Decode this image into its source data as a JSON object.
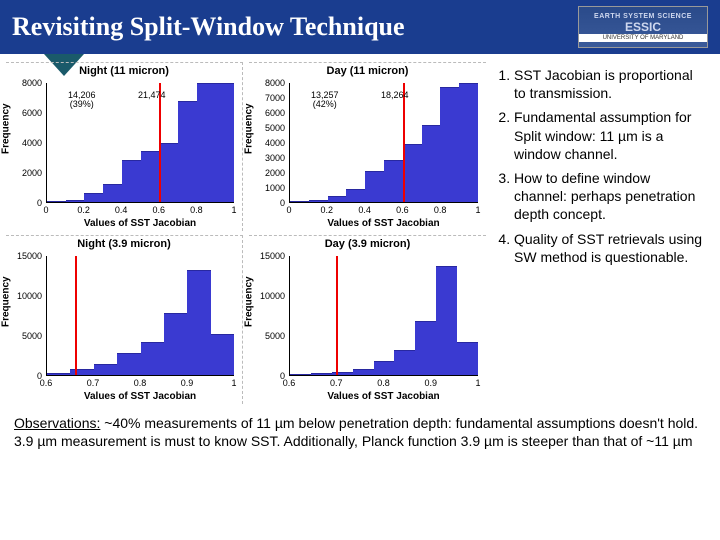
{
  "title": "Revisiting Split-Window Technique",
  "logo": {
    "line1": "EARTH SYSTEM SCIENCE",
    "line2": "UNIVERSITY OF MARYLAND",
    "essic": "ESSIC"
  },
  "charts": [
    {
      "title": "Night (11 micron)",
      "ylabel": "Frequency",
      "xlabel": "Values of SST Jacobian",
      "annot1": "14,206\n(39%)",
      "annot2": "21,474"
    },
    {
      "title": "Day (11 micron)",
      "ylabel": "Frequency",
      "xlabel": "Values of SST Jacobian",
      "annot1": "13,257\n(42%)",
      "annot2": "18,264"
    },
    {
      "title": "Night (3.9 micron)",
      "ylabel": "Frequency",
      "xlabel": "Values of SST Jacobian"
    },
    {
      "title": "Day (3.9 micron)",
      "ylabel": "Frequency",
      "xlabel": "Values of SST Jacobian"
    }
  ],
  "yticks": {
    "a": [
      "0",
      "2000",
      "4000",
      "6000",
      "8000"
    ],
    "b": [
      "0",
      "1000",
      "2000",
      "3000",
      "4000",
      "5000",
      "6000",
      "7000",
      "8000"
    ],
    "c": [
      "0",
      "5000",
      "10000",
      "15000"
    ],
    "d": [
      "0",
      "5000",
      "10000",
      "15000"
    ]
  },
  "xticks": {
    "wide": [
      "0",
      "0.2",
      "0.4",
      "0.6",
      "0.8",
      "1"
    ],
    "narrow": [
      "0.6",
      "0.7",
      "0.8",
      "0.9",
      "1"
    ]
  },
  "notes": [
    "SST Jacobian is proportional to transmission.",
    "Fundamental assumption for Split window: 11 µm is a window channel.",
    "How to define window channel: perhaps penetration depth concept.",
    "Quality of SST retrievals using SW method is questionable."
  ],
  "obs_label": "Observations:",
  "obs": " ~40% measurements of 11 µm below penetration depth: fundamental assumptions doesn't hold. 3.9 µm measurement is must to know SST. Additionally, Planck function 3.9 µm is steeper than that of ~11 µm",
  "chart_data": [
    {
      "type": "bar",
      "title": "Night (11 micron)",
      "xlabel": "Values of SST Jacobian",
      "ylabel": "Frequency",
      "xlim": [
        0,
        1
      ],
      "ylim": [
        0,
        8000
      ],
      "redline_x": 0.6,
      "bin_edges": [
        0,
        0.1,
        0.2,
        0.3,
        0.4,
        0.5,
        0.6,
        0.7,
        0.8,
        0.9,
        1.0
      ],
      "values": [
        0,
        150,
        600,
        1200,
        2800,
        3400,
        4000,
        6800,
        8300,
        8300
      ],
      "annotations": [
        {
          "text": "14,206 (39%)",
          "x": 0.35,
          "y": 7000
        },
        {
          "text": "21,474",
          "x": 0.78,
          "y": 7400
        }
      ]
    },
    {
      "type": "bar",
      "title": "Day (11 micron)",
      "xlabel": "Values of SST Jacobian",
      "ylabel": "Frequency",
      "xlim": [
        0,
        1
      ],
      "ylim": [
        0,
        8000
      ],
      "redline_x": 0.6,
      "bin_edges": [
        0,
        0.1,
        0.2,
        0.3,
        0.4,
        0.5,
        0.6,
        0.7,
        0.8,
        0.9,
        1.0
      ],
      "values": [
        0,
        150,
        400,
        900,
        2100,
        2800,
        3900,
        5200,
        7700,
        8100
      ],
      "annotations": [
        {
          "text": "13,257 (42%)",
          "x": 0.48,
          "y": 6600
        },
        {
          "text": "18,264",
          "x": 0.78,
          "y": 6800
        }
      ]
    },
    {
      "type": "bar",
      "title": "Night (3.9 micron)",
      "xlabel": "Values of SST Jacobian",
      "ylabel": "Frequency",
      "xlim": [
        0.6,
        1.0
      ],
      "ylim": [
        0,
        15000
      ],
      "redline_x": 0.66,
      "bin_edges": [
        0.6,
        0.65,
        0.7,
        0.75,
        0.8,
        0.85,
        0.9,
        0.95,
        1.0
      ],
      "values": [
        200,
        800,
        1400,
        2800,
        4200,
        7800,
        13200,
        5200
      ]
    },
    {
      "type": "bar",
      "title": "Day (3.9 micron)",
      "xlabel": "Values of SST Jacobian",
      "ylabel": "Frequency",
      "xlim": [
        0.55,
        1.0
      ],
      "ylim": [
        0,
        15000
      ],
      "redline_x": 0.66,
      "bin_edges": [
        0.55,
        0.6,
        0.65,
        0.7,
        0.75,
        0.8,
        0.85,
        0.9,
        0.95,
        1.0
      ],
      "values": [
        50,
        200,
        400,
        800,
        1800,
        3200,
        6800,
        13800,
        4200
      ]
    }
  ]
}
